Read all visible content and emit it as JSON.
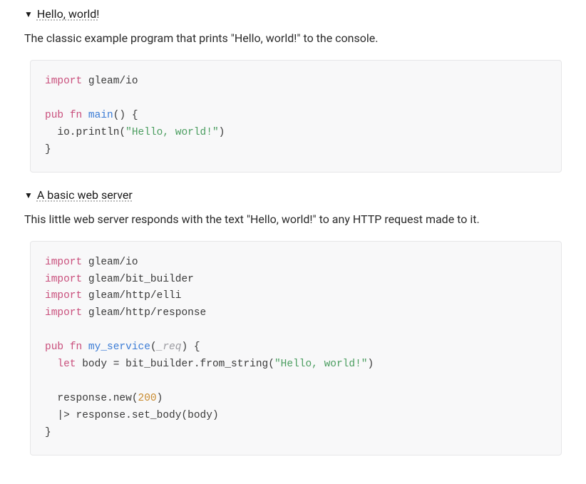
{
  "sections": [
    {
      "title": "Hello, world!",
      "desc": "The classic example program that prints \"Hello, world!\" to the console.",
      "code": [
        [
          [
            "kw",
            "import"
          ],
          [
            "pl",
            " gleam/io"
          ]
        ],
        [],
        [
          [
            "kw",
            "pub"
          ],
          [
            "pl",
            " "
          ],
          [
            "kw",
            "fn"
          ],
          [
            "pl",
            " "
          ],
          [
            "fn",
            "main"
          ],
          [
            "pl",
            "() {"
          ]
        ],
        [
          [
            "pl",
            "  io.println("
          ],
          [
            "str",
            "\"Hello, world!\""
          ],
          [
            "pl",
            ")"
          ]
        ],
        [
          [
            "pl",
            "}"
          ]
        ]
      ]
    },
    {
      "title": "A basic web server",
      "desc": "This little web server responds with the text \"Hello, world!\" to any HTTP request made to it.",
      "code": [
        [
          [
            "kw",
            "import"
          ],
          [
            "pl",
            " gleam/io"
          ]
        ],
        [
          [
            "kw",
            "import"
          ],
          [
            "pl",
            " gleam/bit_builder"
          ]
        ],
        [
          [
            "kw",
            "import"
          ],
          [
            "pl",
            " gleam/http/elli"
          ]
        ],
        [
          [
            "kw",
            "import"
          ],
          [
            "pl",
            " gleam/http/response"
          ]
        ],
        [],
        [
          [
            "kw",
            "pub"
          ],
          [
            "pl",
            " "
          ],
          [
            "kw",
            "fn"
          ],
          [
            "pl",
            " "
          ],
          [
            "fn",
            "my_service"
          ],
          [
            "pl",
            "("
          ],
          [
            "arg",
            "_req"
          ],
          [
            "pl",
            ") {"
          ]
        ],
        [
          [
            "pl",
            "  "
          ],
          [
            "kw",
            "let"
          ],
          [
            "pl",
            " body = bit_builder.from_string("
          ],
          [
            "str",
            "\"Hello, world!\""
          ],
          [
            "pl",
            ")"
          ]
        ],
        [],
        [
          [
            "pl",
            "  response.new("
          ],
          [
            "num",
            "200"
          ],
          [
            "pl",
            ")"
          ]
        ],
        [
          [
            "pl",
            "  |> response.set_body(body)"
          ]
        ],
        [
          [
            "pl",
            "}"
          ]
        ]
      ]
    }
  ]
}
